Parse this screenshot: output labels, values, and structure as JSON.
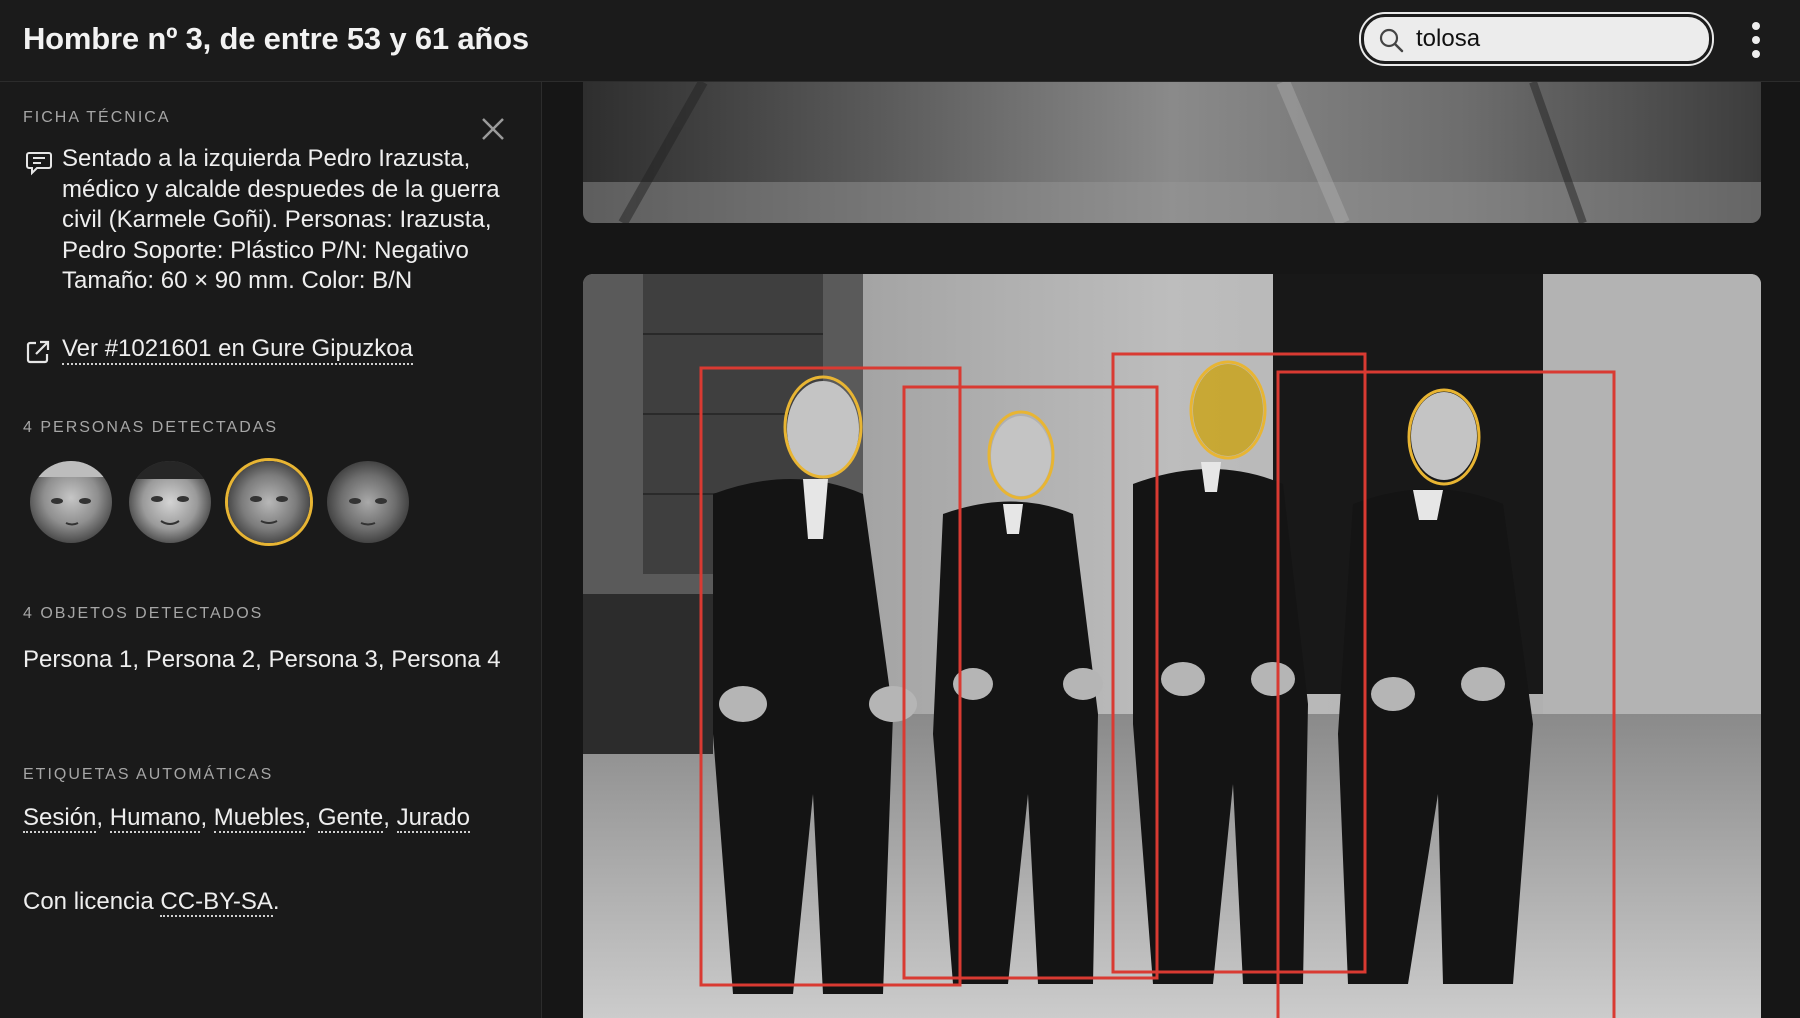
{
  "header": {
    "title": "Hombre nº 3, de entre 53 y 61 años",
    "search_value": "tolosa"
  },
  "sidebar": {
    "ficha_label": "FICHA TÉCNICA",
    "description": "Sentado a la izquierda Pedro Irazusta, médico y alcalde despuedes de la guerra civil (Karmele Goñi). Personas: Irazusta, Pedro Soporte: Plástico P/N: Negativo Tamaño: 60 × 90 mm. Color: B/N",
    "source_link": "Ver #1021601 en Gure Gipuzkoa",
    "persons_label": "4 PERSONAS DETECTADAS",
    "faces_count": 4,
    "selected_face_index": 2,
    "objects_label": "4 OBJETOS DETECTADOS",
    "objects_text": "Persona 1, Persona 2, Persona 3, Persona 4",
    "tags_label": "ETIQUETAS AUTOMÁTICAS",
    "tags": [
      "Sesión",
      "Humano",
      "Muebles",
      "Gente",
      "Jurado"
    ],
    "license_prefix": "Con licencia ",
    "license_link": "CC-BY-SA",
    "license_suffix": "."
  },
  "colors": {
    "detection_box": "#d93a32",
    "face_outline": "#e8b533",
    "face_highlight": "#c9a526"
  },
  "icons": {
    "search": "search-icon",
    "menu": "more-vertical-icon",
    "close": "close-icon",
    "description": "comment-icon",
    "link": "external-link-icon"
  }
}
